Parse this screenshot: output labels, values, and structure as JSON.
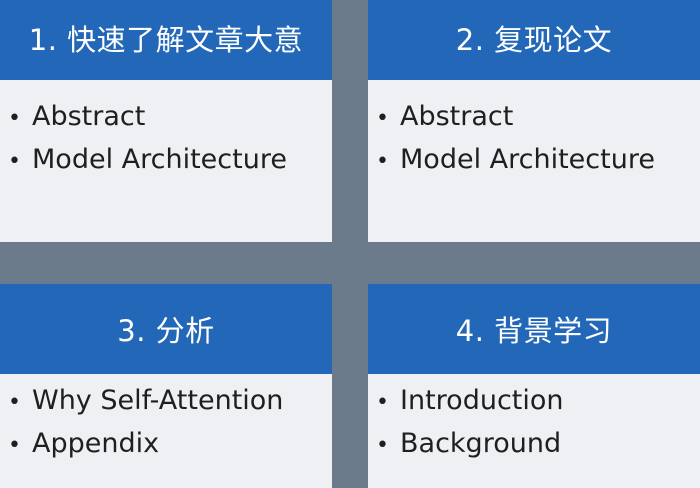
{
  "cards": [
    {
      "title": "1. 快速了解文章大意",
      "items": [
        "Abstract",
        "Model Architecture"
      ]
    },
    {
      "title": "2. 复现论文",
      "items": [
        "Abstract",
        "Model Architecture"
      ]
    },
    {
      "title": "3. 分析",
      "items": [
        "Why Self-Attention",
        "Appendix"
      ]
    },
    {
      "title": "4. 背景学习",
      "items": [
        "Introduction",
        "Background"
      ]
    }
  ],
  "bullet": "•",
  "colors": {
    "header": "#2368b8",
    "card": "#eef0f3",
    "divider": "#6b7b8c"
  }
}
